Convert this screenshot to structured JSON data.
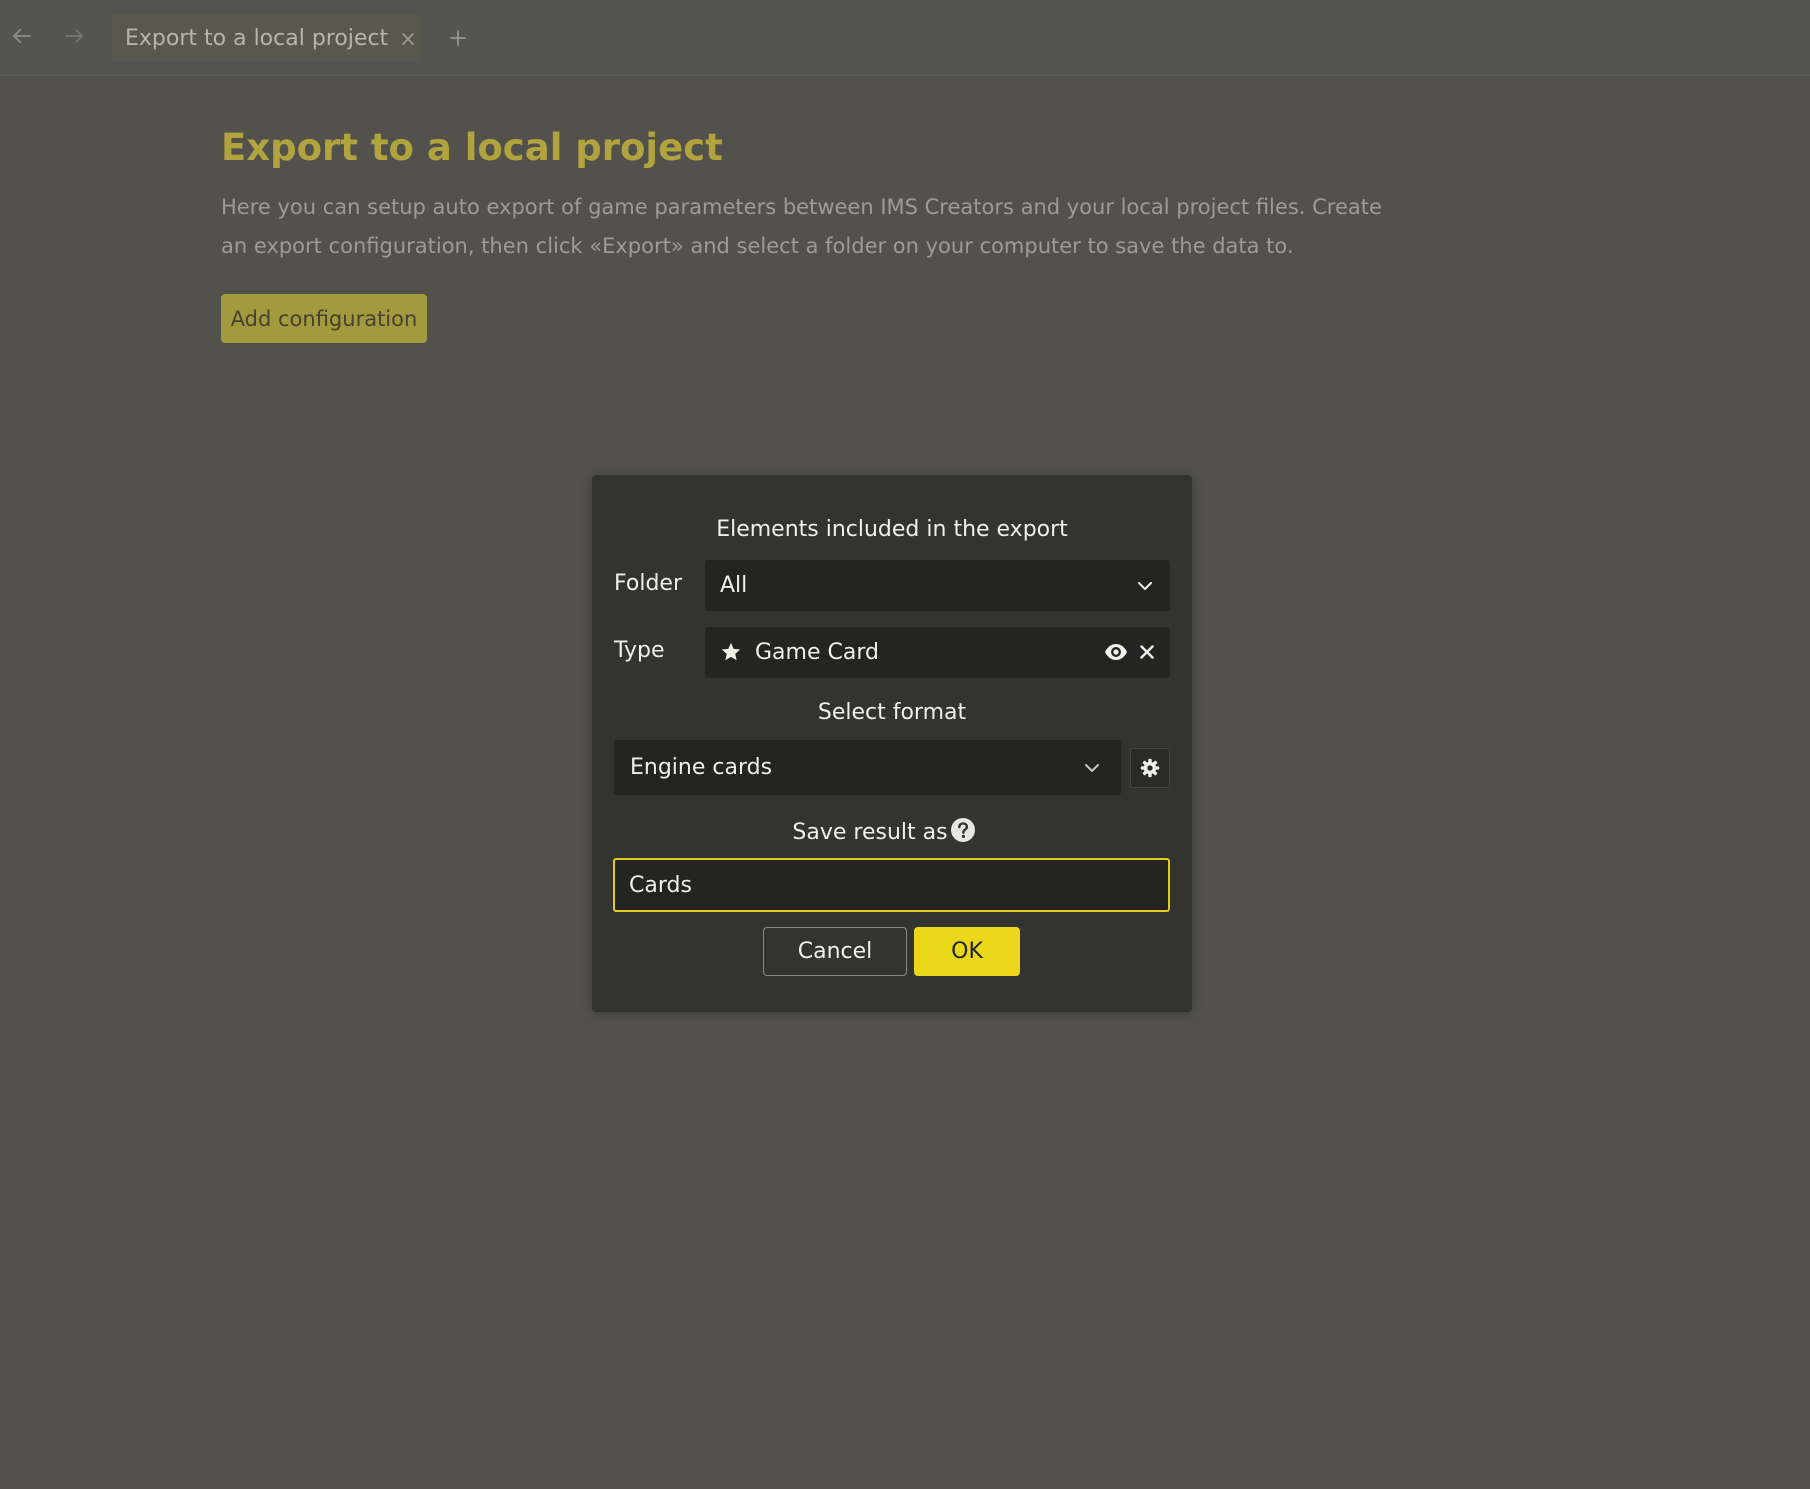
{
  "tabbar": {
    "back_icon": "arrow-left-icon",
    "forward_icon": "arrow-right-icon",
    "tabs": [
      {
        "label": "Export to a local project",
        "close_icon": "close-icon"
      }
    ],
    "add_tab_icon": "plus-icon"
  },
  "page": {
    "title": "Export to a local project",
    "description": "Here you can setup auto export of game parameters between IMS Creators and your local project files. Create an export configuration, then click «Export» and select a folder on your computer to save the data to.",
    "add_config_label": "Add configuration",
    "accent_color": "#b1a33e"
  },
  "dialog": {
    "elements_heading": "Elements included in the export",
    "folder": {
      "label": "Folder",
      "value": "All",
      "icon": "chevron-down-icon"
    },
    "type": {
      "label": "Type",
      "value": "Game Card",
      "leading_icon": "star-icon",
      "view_icon": "eye-icon",
      "clear_icon": "close-icon"
    },
    "format": {
      "heading": "Select format",
      "value": "Engine cards",
      "icon": "chevron-down-icon",
      "settings_icon": "gear-icon"
    },
    "save_as": {
      "heading": "Save result as",
      "help_icon": "question-mark-icon",
      "value": "Cards"
    },
    "cancel_label": "Cancel",
    "ok_label": "OK",
    "ok_color": "#ecd81a",
    "focus_color": "#e2cc1e"
  }
}
